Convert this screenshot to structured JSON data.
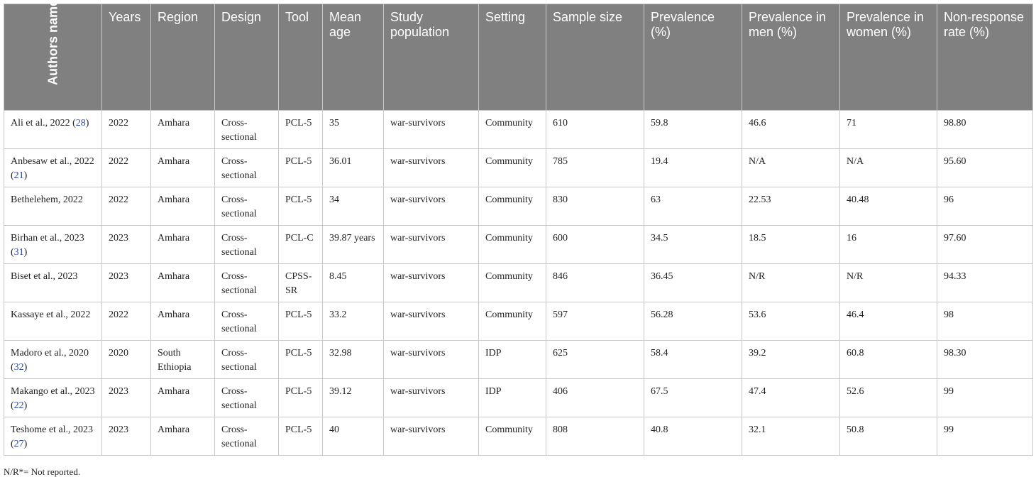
{
  "headers": [
    "Authors name",
    "Years",
    "Region",
    "Design",
    "Tool",
    "Mean age",
    "Study population",
    "Setting",
    "Sample size",
    "Prevalence (%)",
    "Prevalence in men (%)",
    "Prevalence in women (%)",
    "Non-response rate (%)"
  ],
  "rows": [
    {
      "author": "Ali et al., 2022 (",
      "ref": "28",
      "author_end": ")",
      "year": "2022",
      "region": "Amhara",
      "design": "Cross-sectional",
      "tool": "PCL-5",
      "mean_age": "35",
      "population": "war-survivors",
      "setting": "Community",
      "sample": "610",
      "prev": "59.8",
      "prev_men": "46.6",
      "prev_women": "71",
      "nonresp": "98.80"
    },
    {
      "author": "Anbesaw et al., 2022 (",
      "ref": "21",
      "author_end": ")",
      "year": "2022",
      "region": "Amhara",
      "design": "Cross-sectional",
      "tool": "PCL-5",
      "mean_age": "36.01",
      "population": "war-survivors",
      "setting": "Community",
      "sample": "785",
      "prev": "19.4",
      "prev_men": "N/A",
      "prev_women": "N/A",
      "nonresp": "95.60"
    },
    {
      "author": "Bethelehem, 2022",
      "ref": "",
      "author_end": "",
      "year": "2022",
      "region": "Amhara",
      "design": "Cross-sectional",
      "tool": "PCL-5",
      "mean_age": "34",
      "population": "war-survivors",
      "setting": "Community",
      "sample": "830",
      "prev": "63",
      "prev_men": "22.53",
      "prev_women": "40.48",
      "nonresp": "96"
    },
    {
      "author": "Birhan et al., 2023 (",
      "ref": "31",
      "author_end": ")",
      "year": "2023",
      "region": "Amhara",
      "design": "Cross-sectional",
      "tool": "PCL-C",
      "mean_age": "39.87 years",
      "population": "war-survivors",
      "setting": "Community",
      "sample": "600",
      "prev": "34.5",
      "prev_men": "18.5",
      "prev_women": "16",
      "nonresp": "97.60"
    },
    {
      "author": "Biset et al., 2023",
      "ref": "",
      "author_end": "",
      "year": "2023",
      "region": "Amhara",
      "design": "Cross-sectional",
      "tool": "CPSS-SR",
      "mean_age": "8.45",
      "population": "war-survivors",
      "setting": "Community",
      "sample": "846",
      "prev": "36.45",
      "prev_men": "N/R",
      "prev_women": "N/R",
      "nonresp": "94.33"
    },
    {
      "author": "Kassaye et al., 2022",
      "ref": "",
      "author_end": "",
      "year": "2022",
      "region": "Amhara",
      "design": "Cross-sectional",
      "tool": "PCL-5",
      "mean_age": "33.2",
      "population": "war-survivors",
      "setting": "Community",
      "sample": "597",
      "prev": "56.28",
      "prev_men": "53.6",
      "prev_women": "46.4",
      "nonresp": "98"
    },
    {
      "author": "Madoro et al., 2020 (",
      "ref": "32",
      "author_end": ")",
      "year": "2020",
      "region": "South Ethiopia",
      "design": "Cross-sectional",
      "tool": "PCL-5",
      "mean_age": "32.98",
      "population": "war-survivors",
      "setting": "IDP",
      "sample": "625",
      "prev": "58.4",
      "prev_men": "39.2",
      "prev_women": "60.8",
      "nonresp": "98.30"
    },
    {
      "author": "Makango et al., 2023 (",
      "ref": "22",
      "author_end": ")",
      "year": "2023",
      "region": "Amhara",
      "design": "Cross-sectional",
      "tool": "PCL-5",
      "mean_age": "39.12",
      "population": "war-survivors",
      "setting": "IDP",
      "sample": "406",
      "prev": "67.5",
      "prev_men": "47.4",
      "prev_women": "52.6",
      "nonresp": "99"
    },
    {
      "author": "Teshome et al., 2023 (",
      "ref": "27",
      "author_end": ")",
      "year": "2023",
      "region": "Amhara",
      "design": "Cross-sectional",
      "tool": "PCL-5",
      "mean_age": "40",
      "population": "war-survivors",
      "setting": "Community",
      "sample": "808",
      "prev": "40.8",
      "prev_men": "32.1",
      "prev_women": "50.8",
      "nonresp": "99"
    }
  ],
  "footnote": "N/R*= Not reported."
}
